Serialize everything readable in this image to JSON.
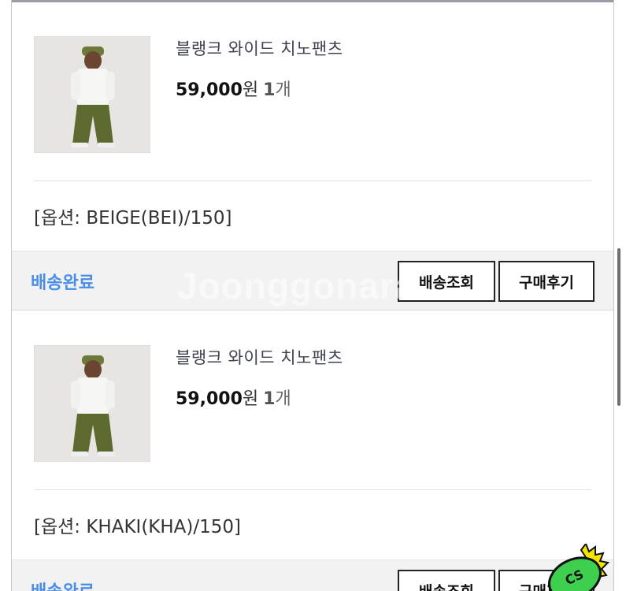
{
  "orders": [
    {
      "product_name": "블랭크 와이드 치노팬츠",
      "price": "59,000",
      "currency_unit": "원",
      "quantity": "1",
      "quantity_unit": "개",
      "option": "[옵션: BEIGE(BEI)/150]",
      "status": "배송완료",
      "track_button": "배송조회",
      "review_button": "구매후기"
    },
    {
      "product_name": "블랭크 와이드 치노팬츠",
      "price": "59,000",
      "currency_unit": "원",
      "quantity": "1",
      "quantity_unit": "개",
      "option": "[옵션: KHAKI(KHA)/150]",
      "status": "배송완료",
      "track_button": "배송조회",
      "review_button": "구매후기"
    }
  ],
  "watermark": "Joonggonara",
  "badge_text": "CS",
  "colors": {
    "status_blue": "#4a8ee8",
    "status_bar_bg": "#f2f2f2",
    "badge_green": "#3ecf4f",
    "badge_yellow": "#f3e500"
  },
  "icons": [
    "product-thumbnail",
    "cs-badge-icon"
  ]
}
